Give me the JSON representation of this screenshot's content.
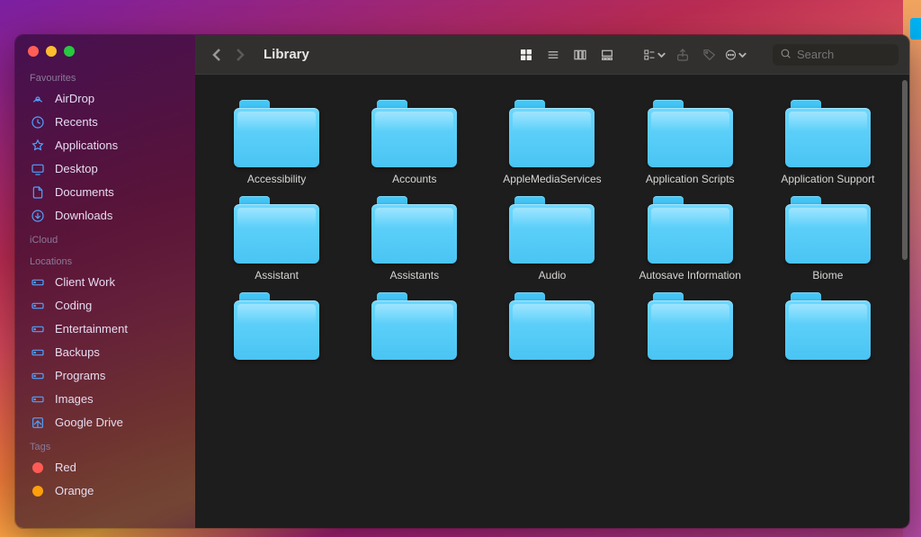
{
  "window": {
    "title": "Library"
  },
  "toolbar": {
    "search_placeholder": "Search"
  },
  "sidebar": {
    "sections": {
      "favourites_label": "Favourites",
      "icloud_label": "iCloud",
      "locations_label": "Locations",
      "tags_label": "Tags"
    },
    "favourites": [
      {
        "name": "AirDrop",
        "icon": "airdrop"
      },
      {
        "name": "Recents",
        "icon": "clock"
      },
      {
        "name": "Applications",
        "icon": "apps"
      },
      {
        "name": "Desktop",
        "icon": "desktop"
      },
      {
        "name": "Documents",
        "icon": "document"
      },
      {
        "name": "Downloads",
        "icon": "download"
      }
    ],
    "locations": [
      {
        "name": "Client Work",
        "icon": "drive"
      },
      {
        "name": "Coding",
        "icon": "drive"
      },
      {
        "name": "Entertainment",
        "icon": "drive"
      },
      {
        "name": "Backups",
        "icon": "drive"
      },
      {
        "name": "Programs",
        "icon": "drive"
      },
      {
        "name": "Images",
        "icon": "drive"
      },
      {
        "name": "Google Drive",
        "icon": "gdrive"
      }
    ],
    "tags": [
      {
        "name": "Red",
        "color": "#ff5b56"
      },
      {
        "name": "Orange",
        "color": "#ff9f0a"
      }
    ]
  },
  "folders": [
    "Accessibility",
    "Accounts",
    "AppleMediaServices",
    "Application Scripts",
    "Application Support",
    "Assistant",
    "Assistants",
    "Audio",
    "Autosave Information",
    "Biome",
    "",
    "",
    "",
    "",
    ""
  ]
}
